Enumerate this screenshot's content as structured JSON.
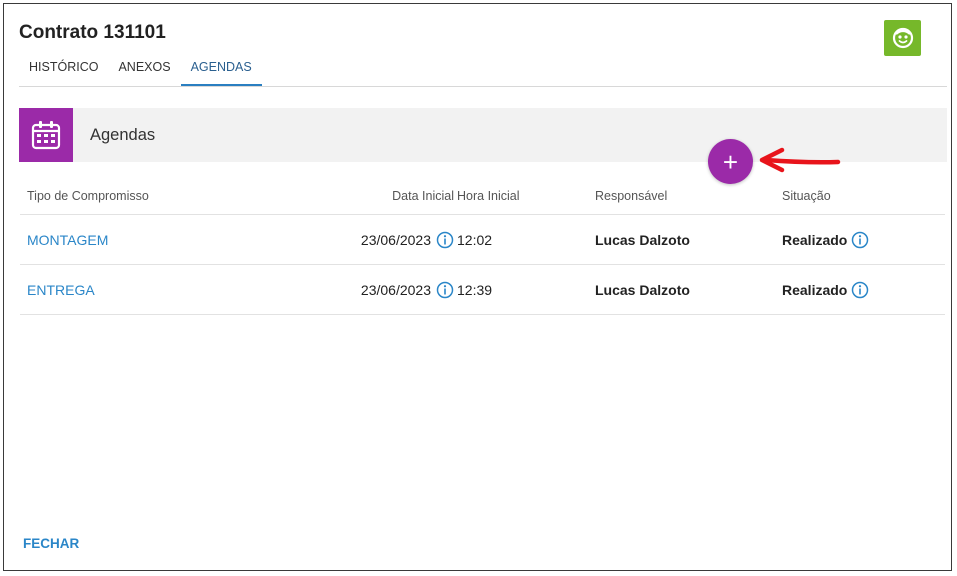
{
  "window": {
    "title": "Contrato 131101"
  },
  "tabs": [
    {
      "label": "HISTÓRICO"
    },
    {
      "label": "ANEXOS"
    },
    {
      "label": "AGENDAS",
      "active": true
    }
  ],
  "section": {
    "title": "Agendas",
    "icon": "calendar-icon",
    "color": "#9b2aa8"
  },
  "add_button": {
    "label": "+"
  },
  "table": {
    "headers": {
      "tipo": "Tipo de Compromisso",
      "data": "Data Inicial",
      "hora": "Hora Inicial",
      "responsavel": "Responsável",
      "situacao": "Situação"
    },
    "rows": [
      {
        "tipo": "MONTAGEM",
        "data": "23/06/2023",
        "hora": "12:02",
        "responsavel": "Lucas Dalzoto",
        "situacao": "Realizado"
      },
      {
        "tipo": "ENTREGA",
        "data": "23/06/2023",
        "hora": "12:39",
        "responsavel": "Lucas Dalzoto",
        "situacao": "Realizado"
      }
    ]
  },
  "footer": {
    "close_label": "FECHAR"
  },
  "colors": {
    "accent_purple": "#9b2aa8",
    "logo_green": "#76b82a",
    "link_blue": "#2a86c8",
    "annotation_red": "#e8141b"
  }
}
